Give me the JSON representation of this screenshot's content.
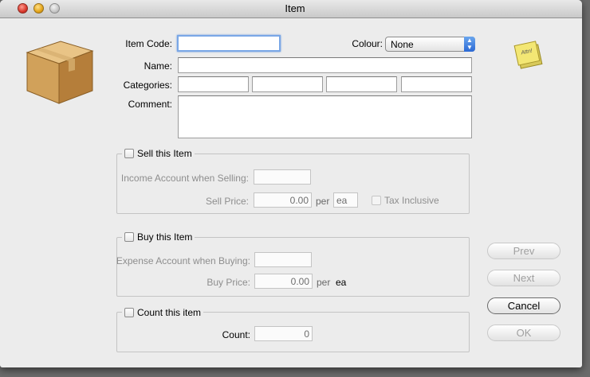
{
  "window": {
    "title": "Item"
  },
  "item_code": {
    "label": "Item Code:",
    "value": ""
  },
  "colour": {
    "label": "Colour:",
    "value": "None"
  },
  "name": {
    "label": "Name:",
    "value": ""
  },
  "categories": {
    "label": "Categories:",
    "values": [
      "",
      "",
      "",
      ""
    ]
  },
  "comment": {
    "label": "Comment:",
    "value": ""
  },
  "note_icon": {
    "text": "Attn!"
  },
  "sell": {
    "title": "Sell this Item",
    "account_label": "Income Account when Selling:",
    "account_value": "",
    "price_label": "Sell Price:",
    "price_value": "0.00",
    "per_label": "per",
    "unit_value": "ea",
    "tax_label": "Tax Inclusive"
  },
  "buy": {
    "title": "Buy this Item",
    "account_label": "Expense Account when Buying:",
    "account_value": "",
    "price_label": "Buy Price:",
    "price_value": "0.00",
    "per_label": "per",
    "unit_text": "ea"
  },
  "count": {
    "title": "Count this item",
    "label": "Count:",
    "value": "0"
  },
  "buttons": {
    "prev": "Prev",
    "next": "Next",
    "cancel": "Cancel",
    "ok": "OK"
  }
}
